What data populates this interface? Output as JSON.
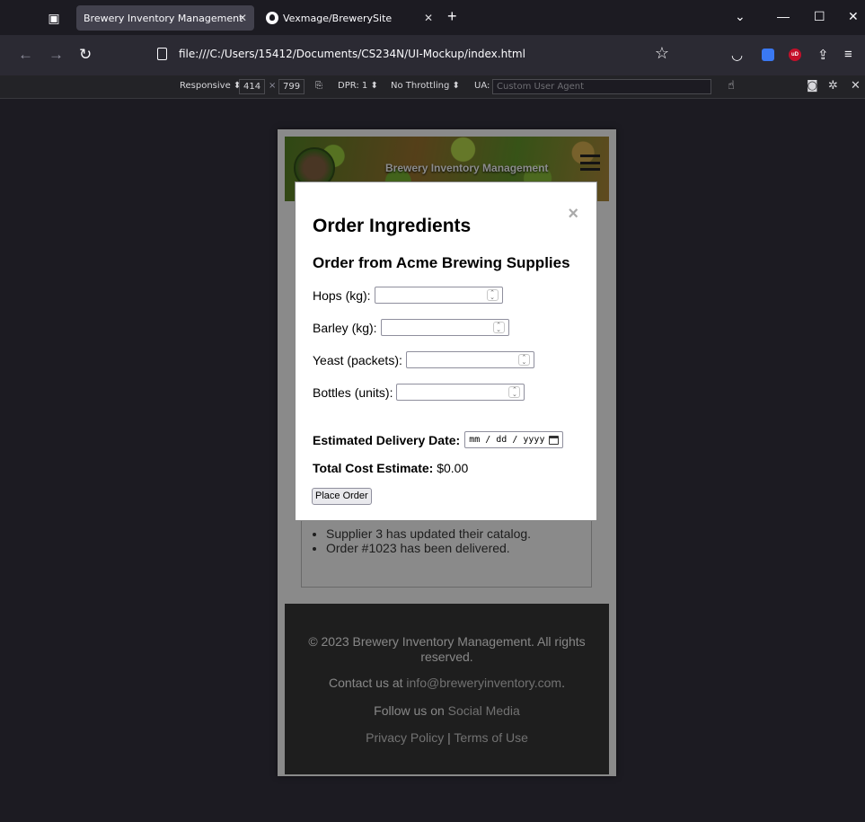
{
  "browser": {
    "tabs": [
      {
        "title": "Brewery Inventory Management",
        "active": true
      },
      {
        "title": "Vexmage/BrewerySite",
        "active": false
      }
    ],
    "url": "file:///C:/Users/15412/Documents/CS234N/UI-Mockup/index.html",
    "responsive": {
      "device": "Responsive",
      "width": "414",
      "height": "799",
      "dpr": "DPR: 1",
      "throttling": "No Throttling",
      "ua_label": "UA:",
      "ua_placeholder": "Custom User Agent"
    }
  },
  "site": {
    "title": "Brewery Inventory Management"
  },
  "notifications": [
    "Supplier 3 has updated their catalog.",
    "Order #1023 has been delivered."
  ],
  "footer": {
    "copyright": "© 2023 Brewery Inventory Management. All rights reserved.",
    "contact_prefix": "Contact us at",
    "contact_email": "info@breweryinventory.com",
    "contact_suffix": ".",
    "follow_prefix": "Follow us on",
    "follow_link": "Social Media",
    "privacy": "Privacy Policy",
    "separator": "|",
    "terms": "Terms of Use"
  },
  "modal": {
    "close": "×",
    "title": "Order Ingredients",
    "subtitle": "Order from Acme Brewing Supplies",
    "fields": [
      {
        "label": "Hops (kg):",
        "value": ""
      },
      {
        "label": "Barley (kg):",
        "value": ""
      },
      {
        "label": "Yeast (packets):",
        "value": ""
      },
      {
        "label": "Bottles (units):",
        "value": ""
      }
    ],
    "delivery_label": "Estimated Delivery Date:",
    "delivery_placeholder": "mm / dd / yyyy",
    "total_label": "Total Cost Estimate:",
    "total_value": "$0.00",
    "place_order": "Place Order"
  }
}
